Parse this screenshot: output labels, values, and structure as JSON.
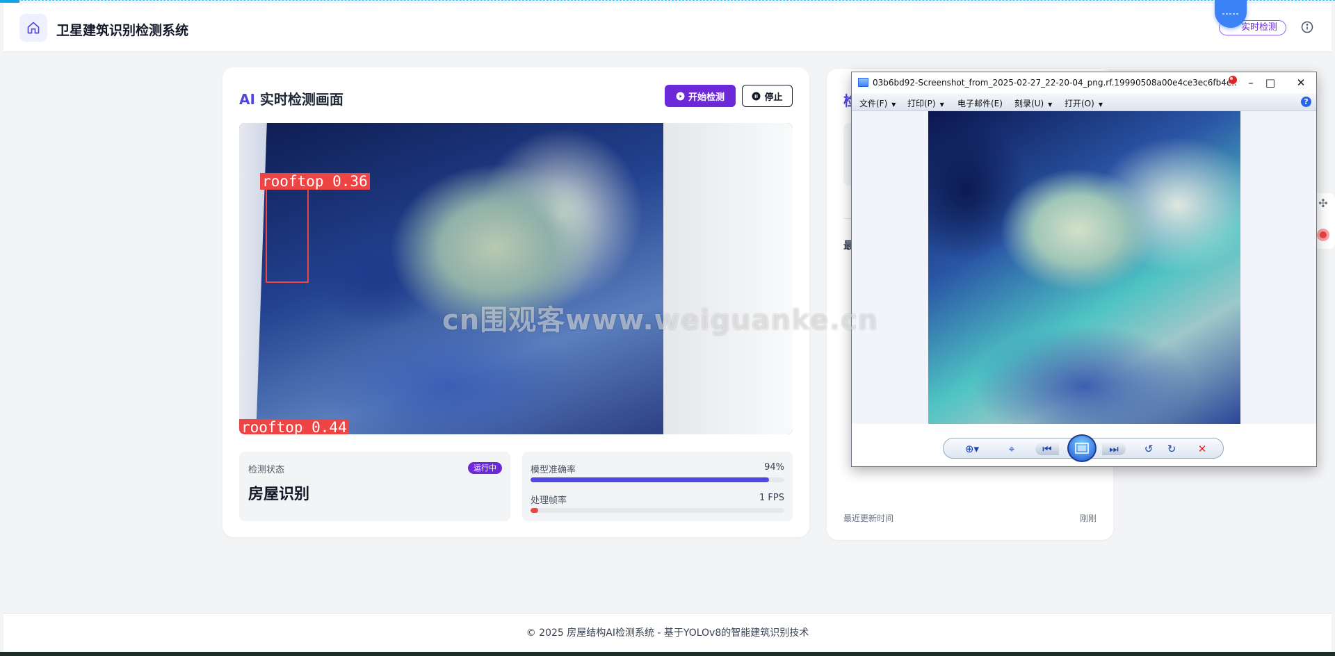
{
  "header": {
    "title": "卫星建筑识别检测系统",
    "realtime_badge": "实时检测"
  },
  "main": {
    "title_ai": "AI",
    "title_rest": " 实时检测画面",
    "start_button": "开始检测",
    "stop_button": "停止",
    "detections": [
      {
        "label": "rooftop 0.36"
      },
      {
        "label": "rooftop 0.44"
      }
    ],
    "status": {
      "label": "检测状态",
      "badge": "运行中",
      "value": "房屋识别"
    },
    "metrics": [
      {
        "name": "模型准确率",
        "value": "94%",
        "fraction": 0.94,
        "color": "#4f46e5"
      },
      {
        "name": "处理帧率",
        "value": "1 FPS",
        "fraction": 0.03,
        "color": "#ef4444"
      }
    ]
  },
  "right_panel": {
    "title_fragment": "检",
    "sub_fragment": "最",
    "last_update_label": "最近更新时间",
    "last_update_value": "刚刚"
  },
  "viewer": {
    "title": "03b6bd92-Screenshot_from_2025-02-27_22-20-04_png.rf.19990508a00e4ce3ec6fb4e...",
    "menus": [
      {
        "label": "文件(F)"
      },
      {
        "label": "打印(P)"
      },
      {
        "label": "电子邮件(E)"
      },
      {
        "label": "刻录(U)"
      },
      {
        "label": "打开(O)"
      }
    ],
    "help": "?"
  },
  "footer": {
    "text": "© 2025 房屋结构AI检测系统 - 基于YOLOv8的智能建筑识别技术"
  },
  "watermark": "cn围观客www.weiguanke.cn"
}
